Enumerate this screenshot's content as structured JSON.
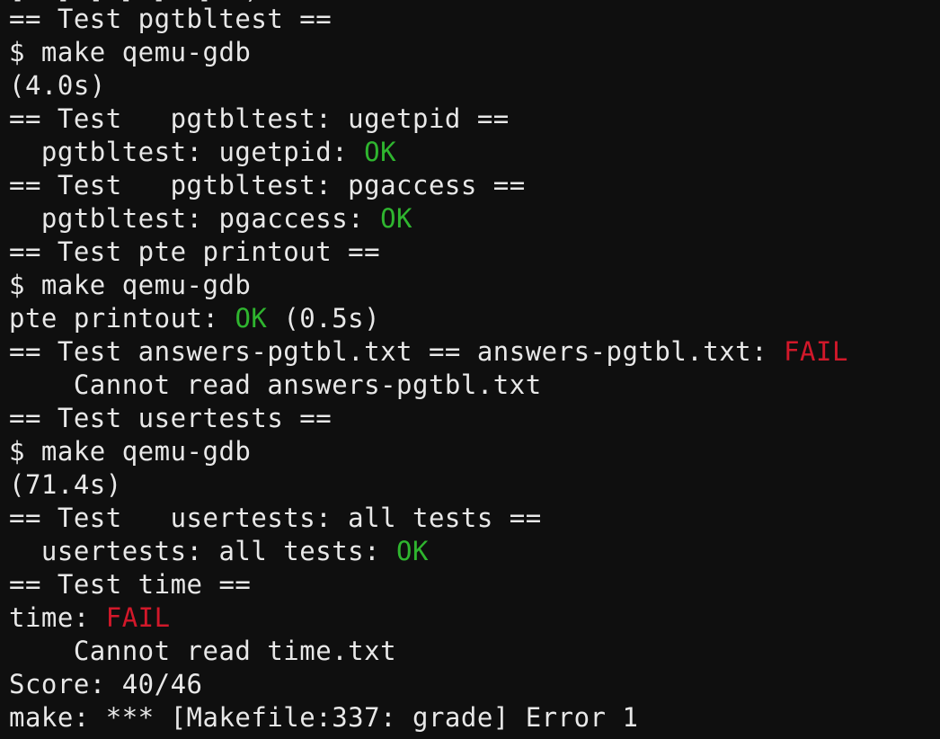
{
  "terminal": {
    "clipped_top_line": "[  ] [ ] [  ]  ) ",
    "lines": [
      {
        "text": "== Test pgtbltest =="
      },
      {
        "text": "$ make qemu-gdb"
      },
      {
        "text": "(4.0s)"
      },
      {
        "text": "== Test   pgtbltest: ugetpid =="
      },
      {
        "text": "  pgtbltest: ugetpid: ",
        "status": "OK",
        "status_kind": "ok"
      },
      {
        "text": "== Test   pgtbltest: pgaccess =="
      },
      {
        "text": "  pgtbltest: pgaccess: ",
        "status": "OK",
        "status_kind": "ok"
      },
      {
        "text": "== Test pte printout =="
      },
      {
        "text": "$ make qemu-gdb"
      },
      {
        "text": "pte printout: ",
        "status": "OK",
        "status_kind": "ok",
        "suffix": " (0.5s)"
      },
      {
        "text": "== Test answers-pgtbl.txt == answers-pgtbl.txt: ",
        "status": "FAIL",
        "status_kind": "fail"
      },
      {
        "text": "    Cannot read answers-pgtbl.txt"
      },
      {
        "text": "== Test usertests =="
      },
      {
        "text": "$ make qemu-gdb"
      },
      {
        "text": "(71.4s)"
      },
      {
        "text": "== Test   usertests: all tests =="
      },
      {
        "text": "  usertests: all tests: ",
        "status": "OK",
        "status_kind": "ok"
      },
      {
        "text": "== Test time =="
      },
      {
        "text": "time: ",
        "status": "FAIL",
        "status_kind": "fail"
      },
      {
        "text": "    Cannot read time.txt"
      },
      {
        "text": "Score: 40/46"
      },
      {
        "text": "make: *** [Makefile:337: grade] Error 1"
      }
    ]
  },
  "colors": {
    "background": "#0f0f0f",
    "text": "#e8e8e8",
    "ok": "#2fb52f",
    "fail": "#d2182a"
  }
}
